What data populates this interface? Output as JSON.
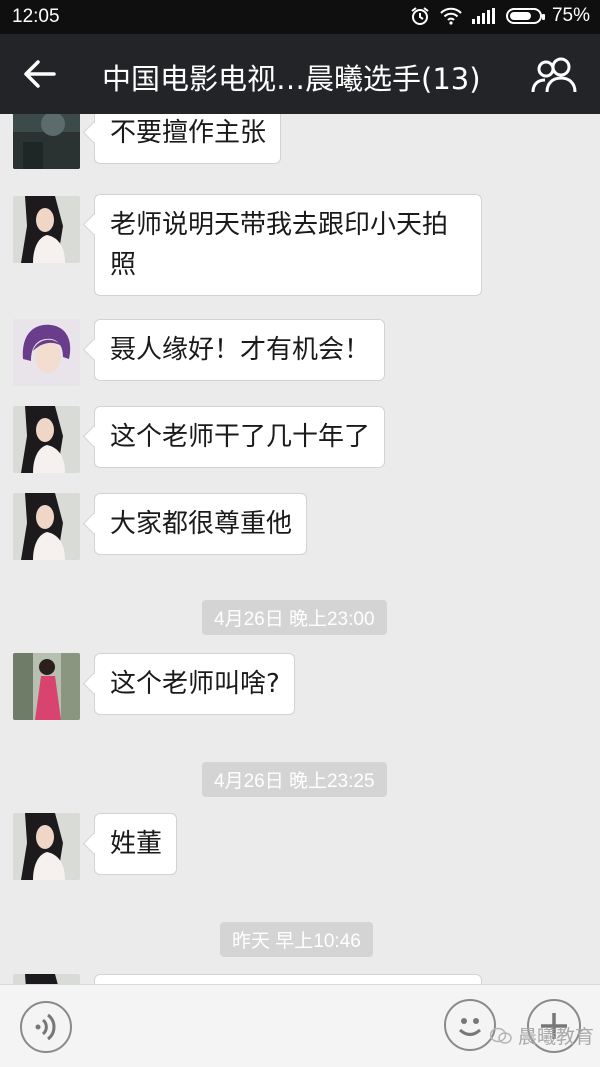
{
  "status_bar": {
    "time": "12:05",
    "battery": "75%",
    "battery_level": 0.75
  },
  "header": {
    "title": "中国电影电视…晨曦选手(13)"
  },
  "messages": [
    {
      "text": "不要擅作主张",
      "avatar": "dark-photo-avatar"
    },
    {
      "text_line1": "老师说明天带我去跟印小天拍",
      "text_line2": "照",
      "avatar": "woman-white-dress-avatar"
    },
    {
      "text": "聂人缘好！才有机会！",
      "avatar": "purple-hair-avatar"
    },
    {
      "text": "这个老师干了几十年了",
      "avatar": "woman-white-dress-avatar"
    },
    {
      "text": "大家都很尊重他",
      "avatar": "woman-white-dress-avatar"
    },
    {
      "text": "这个老师叫啥?",
      "avatar": "woman-red-dress-avatar"
    },
    {
      "text": "姓董",
      "avatar": "woman-white-dress-avatar"
    }
  ],
  "timestamps": [
    "4月26日 晚上23:00",
    "4月26日 晚上23:25",
    "昨天 早上10:46"
  ],
  "watermark": "晨曦教育"
}
